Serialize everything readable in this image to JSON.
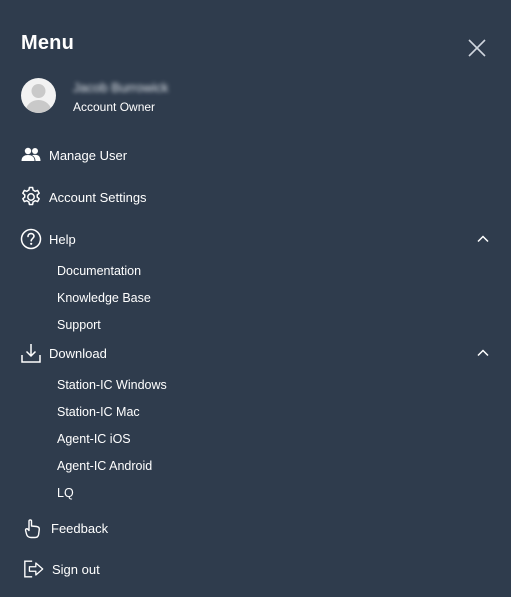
{
  "menu": {
    "title": "Menu",
    "close_icon": "close-icon"
  },
  "profile": {
    "name": "Jacob Burrowick",
    "role": "Account Owner"
  },
  "nav": {
    "manage_user": {
      "label": "Manage User",
      "icon": "users-icon"
    },
    "account_settings": {
      "label": "Account Settings",
      "icon": "gear-icon"
    },
    "help": {
      "label": "Help",
      "icon": "question-circle-icon",
      "expanded": true,
      "items": [
        "Documentation",
        "Knowledge Base",
        "Support"
      ]
    },
    "download": {
      "label": "Download",
      "icon": "download-icon",
      "expanded": true,
      "items": [
        "Station-IC Windows",
        "Station-IC Mac",
        "Agent-IC iOS",
        "Agent-IC Android",
        "LQ"
      ]
    },
    "feedback": {
      "label": "Feedback",
      "icon": "thumbs-up-icon"
    },
    "sign_out": {
      "label": "Sign out",
      "icon": "sign-out-icon"
    }
  },
  "colors": {
    "background": "#2f3c4d",
    "text": "#ffffff"
  }
}
